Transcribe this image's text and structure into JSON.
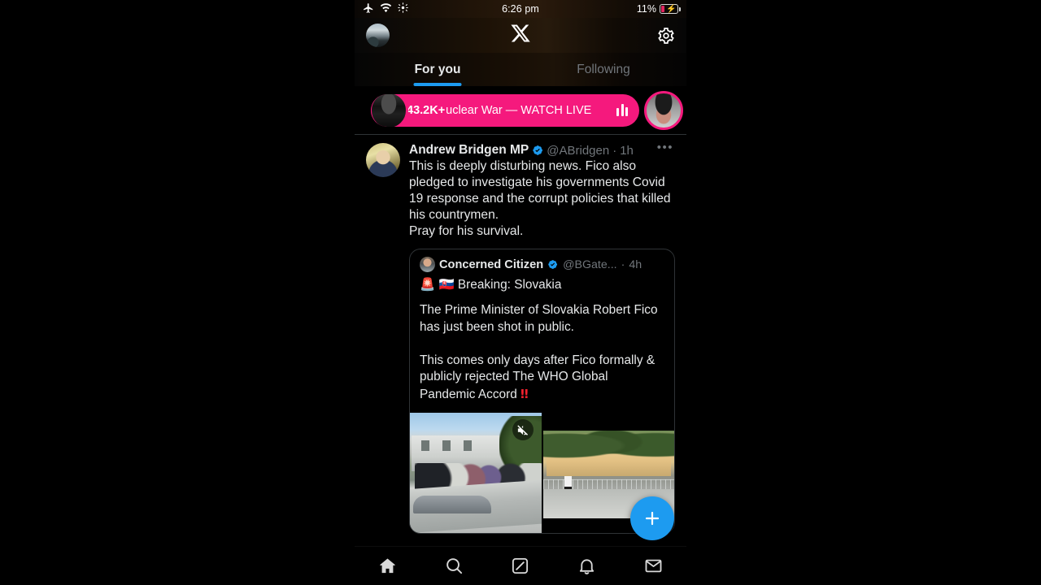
{
  "status_bar": {
    "icons": [
      "airplane-mode-icon",
      "wifi-icon",
      "sync-icon"
    ],
    "time": "6:26 pm",
    "battery_percent": "11%",
    "battery_state": "charging"
  },
  "header": {
    "avatar_name": "profile-avatar",
    "logo": "x-logo",
    "logo_glyph": "𝕏",
    "settings_icon": "gear-icon"
  },
  "tabs": [
    {
      "label": "For you",
      "active": true
    },
    {
      "label": "Following",
      "active": false
    }
  ],
  "live_banner": {
    "count": "43.2K+",
    "text": "uclear War — WATCH LIVE",
    "host_avatar": "live-host-avatar",
    "guest_avatar": "live-guest-avatar",
    "audio_icon": "audio-bars-icon"
  },
  "tweet": {
    "author": "Andrew Bridgen MP",
    "verified": true,
    "handle": "@ABridgen",
    "separator": "·",
    "time": "1h",
    "more": "•••",
    "text": "This is deeply disturbing news. Fico also pledged to investigate his governments Covid 19 response and the corrupt policies that killed his countrymen.\nPray for his survival.",
    "quoted": {
      "author": "Concerned Citizen",
      "verified": true,
      "handle": "@BGate...",
      "separator": "·",
      "time": "4h",
      "headline_emoji_siren": "🚨",
      "headline_emoji_flag": "🇸🇰",
      "headline": "Breaking: Slovakia",
      "text": "The Prime Minister of Slovakia Robert Fico has just been shot in public.\n\nThis comes only days after Fico formally & publicly rejected The WHO Global Pandemic Accord ",
      "text_end_emoji": "‼",
      "media": [
        {
          "name": "media-video-crowd",
          "badge": "muted-audio-icon"
        },
        {
          "name": "media-photo-street",
          "badge": ""
        }
      ]
    }
  },
  "compose_fab": {
    "icon": "plus-icon",
    "label": "+",
    "color": "#1d9bf0"
  },
  "bottom_nav": [
    {
      "name": "home",
      "icon": "home-icon",
      "active": true
    },
    {
      "name": "search",
      "icon": "search-icon",
      "active": false
    },
    {
      "name": "grok",
      "icon": "grok-icon",
      "active": false
    },
    {
      "name": "notifications",
      "icon": "bell-icon",
      "active": false
    },
    {
      "name": "messages",
      "icon": "mail-icon",
      "active": false
    }
  ],
  "colors": {
    "accent_blue": "#1d9bf0",
    "live_pink": "#f5197d",
    "text_primary": "#e7e9ea",
    "text_muted": "#71767b",
    "border": "#2f3336",
    "alert_red": "#f4212e"
  }
}
